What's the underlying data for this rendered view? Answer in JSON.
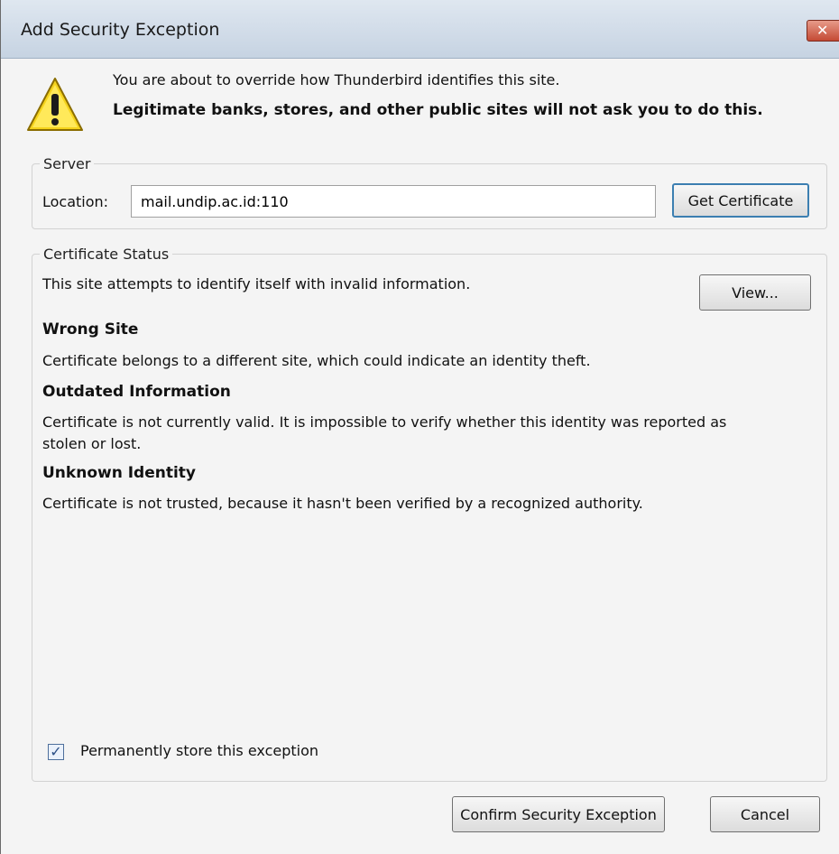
{
  "window": {
    "title": "Add Security Exception",
    "close_glyph": "✕"
  },
  "warning": {
    "icon": "warning-icon",
    "line1": "You are about to override how Thunderbird identifies this site.",
    "line2": "Legitimate banks, stores, and other public sites will not ask you to do this."
  },
  "server": {
    "legend": "Server",
    "location_label": "Location:",
    "location_value": "mail.undip.ac.id:110",
    "get_certificate_label": "Get Certificate"
  },
  "status": {
    "legend": "Certificate Status",
    "intro": "This site attempts to identify itself with invalid information.",
    "view_label": "View...",
    "issues": [
      {
        "heading": "Wrong Site",
        "text": "Certificate belongs to a different site, which could indicate an identity theft."
      },
      {
        "heading": "Outdated Information",
        "text": "Certificate is not currently valid. It is impossible to verify whether this identity was reported as",
        "text2": "stolen or lost."
      },
      {
        "heading": "Unknown Identity",
        "text": "Certificate is not trusted, because it hasn't been verified by a recognized authority."
      }
    ],
    "permanent_label": "Permanently store this exception",
    "permanent_checked": true,
    "check_glyph": "✓"
  },
  "buttons": {
    "confirm": "Confirm Security Exception",
    "cancel": "Cancel"
  }
}
